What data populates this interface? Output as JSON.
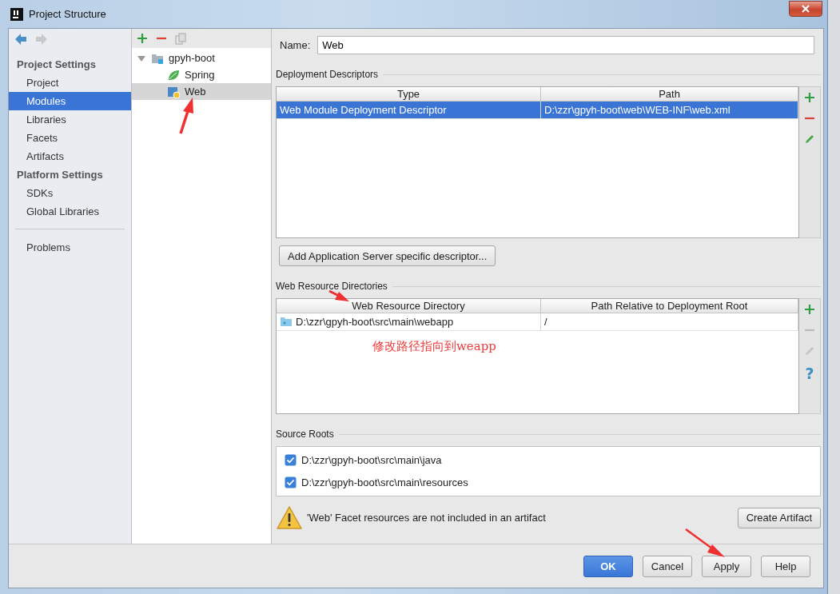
{
  "window": {
    "title": "Project Structure"
  },
  "navigation": {
    "back": {
      "disabled": false
    },
    "forward": {
      "disabled": true
    }
  },
  "sidebar": {
    "sections": [
      {
        "heading": "Project Settings",
        "items": [
          {
            "label": "Project",
            "selected": false
          },
          {
            "label": "Modules",
            "selected": true
          },
          {
            "label": "Libraries",
            "selected": false
          },
          {
            "label": "Facets",
            "selected": false
          },
          {
            "label": "Artifacts",
            "selected": false
          }
        ]
      },
      {
        "heading": "Platform Settings",
        "items": [
          {
            "label": "SDKs",
            "selected": false
          },
          {
            "label": "Global Libraries",
            "selected": false
          }
        ]
      }
    ],
    "extra_items": [
      {
        "label": "Problems",
        "selected": false
      }
    ]
  },
  "module_toolbar": [
    {
      "kind": "add",
      "disabled": false
    },
    {
      "kind": "remove",
      "disabled": false
    },
    {
      "kind": "copy",
      "disabled": true
    }
  ],
  "module_tree": [
    {
      "label": "gpyh-boot",
      "kind": "module",
      "expanded": true,
      "selected": false,
      "children": [
        {
          "label": "Spring",
          "kind": "spring",
          "selected": false
        },
        {
          "label": "Web",
          "kind": "web",
          "selected": true
        }
      ]
    }
  ],
  "name_field": {
    "label": "Name:",
    "value": "Web"
  },
  "deployment_descriptors": {
    "title": "Deployment Descriptors",
    "columns": [
      "Type",
      "Path"
    ],
    "rows": [
      {
        "cells": [
          "Web Module Deployment Descriptor",
          "D:\\zzr\\gpyh-boot\\web\\WEB-INF\\web.xml"
        ],
        "selected": true
      }
    ],
    "toolbar": [
      {
        "kind": "add",
        "disabled": false
      },
      {
        "kind": "remove",
        "disabled": false
      },
      {
        "kind": "edit",
        "disabled": false
      }
    ],
    "button": "Add Application Server specific descriptor..."
  },
  "web_resource_directories": {
    "title": "Web Resource Directories",
    "columns": [
      "Web Resource Directory",
      "Path Relative to Deployment Root"
    ],
    "rows": [
      {
        "cells": [
          "D:\\zzr\\gpyh-boot\\src\\main\\webapp",
          "/"
        ],
        "selected": false
      }
    ],
    "toolbar": [
      {
        "kind": "add",
        "disabled": false
      },
      {
        "kind": "remove",
        "disabled": true
      },
      {
        "kind": "edit",
        "disabled": true
      },
      {
        "kind": "help",
        "label": "?",
        "disabled": false
      }
    ],
    "annotation": "修改路径指向到weapp"
  },
  "source_roots": {
    "title": "Source Roots",
    "items": [
      {
        "path": "D:\\zzr\\gpyh-boot\\src\\main\\java",
        "checked": true
      },
      {
        "path": "D:\\zzr\\gpyh-boot\\src\\main\\resources",
        "checked": true
      }
    ]
  },
  "warning": {
    "text": "'Web' Facet resources are not included in an artifact",
    "button": "Create Artifact"
  },
  "buttons": [
    {
      "label": "OK",
      "kind": "default"
    },
    {
      "label": "Cancel",
      "kind": "normal"
    },
    {
      "label": "Apply",
      "kind": "normal"
    },
    {
      "label": "Help",
      "kind": "normal"
    }
  ]
}
